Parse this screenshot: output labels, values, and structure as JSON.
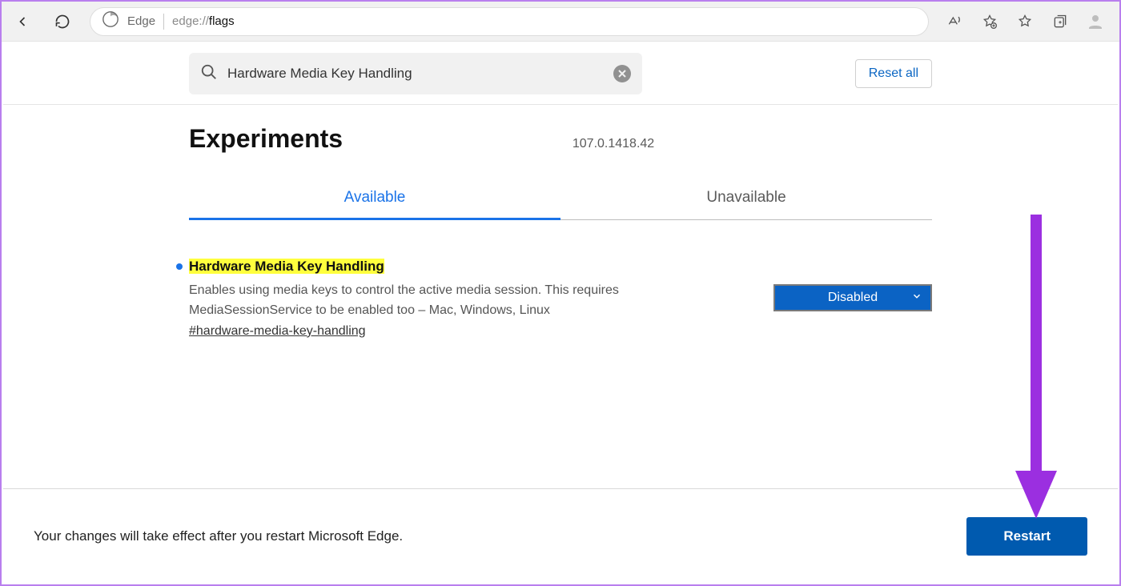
{
  "chrome": {
    "edge_label": "Edge",
    "url_prefix": "edge://",
    "url_path": "flags"
  },
  "search": {
    "value": "Hardware Media Key Handling",
    "reset_label": "Reset all"
  },
  "header": {
    "title": "Experiments",
    "version": "107.0.1418.42"
  },
  "tabs": {
    "available": "Available",
    "unavailable": "Unavailable"
  },
  "flag": {
    "title": "Hardware Media Key Handling",
    "description": "Enables using media keys to control the active media session. This requires MediaSessionService to be enabled too – Mac, Windows, Linux",
    "hash": "#hardware-media-key-handling",
    "state": "Disabled"
  },
  "footer": {
    "message": "Your changes will take effect after you restart Microsoft Edge.",
    "restart_label": "Restart"
  }
}
